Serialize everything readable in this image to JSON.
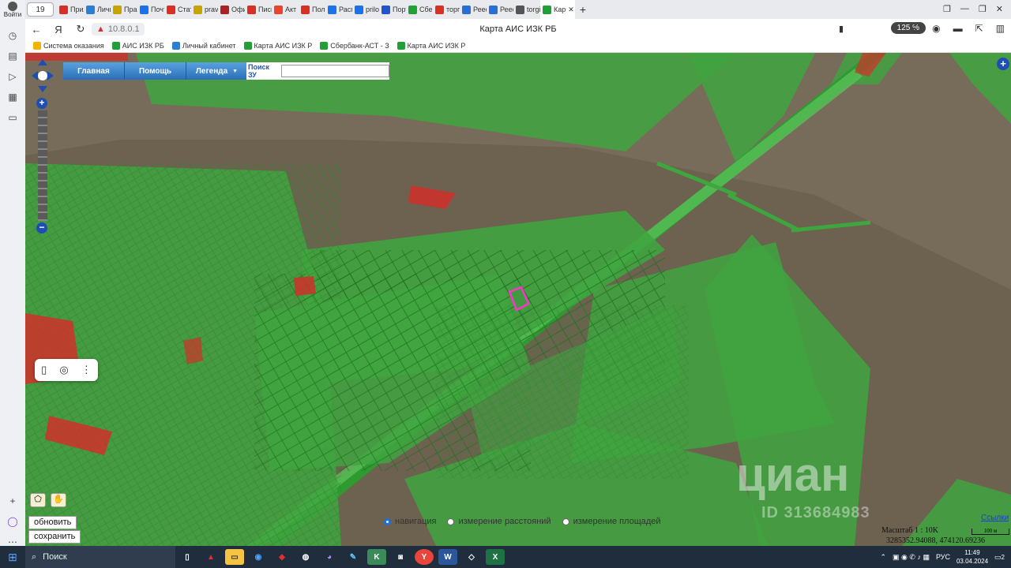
{
  "browser": {
    "tab_count": "19",
    "tabs": [
      {
        "label": "Прило",
        "color": "#d93025"
      },
      {
        "label": "Личн",
        "color": "#2a7fd4"
      },
      {
        "label": "Прави",
        "color": "#c8a400"
      },
      {
        "label": "Почта",
        "color": "#1a73e8"
      },
      {
        "label": "Стати",
        "color": "#d93025"
      },
      {
        "label": "pravo",
        "color": "#c8a400"
      },
      {
        "label": "Офиц",
        "color": "#aa2222"
      },
      {
        "label": "Письм",
        "color": "#d93025"
      },
      {
        "label": "Акт пр",
        "color": "#e8452c"
      },
      {
        "label": "Полож",
        "color": "#d93025"
      },
      {
        "label": "Распо",
        "color": "#1a73e8"
      },
      {
        "label": "prilozh",
        "color": "#1a73e8"
      },
      {
        "label": "Портa",
        "color": "#2255cc"
      },
      {
        "label": "Сберб",
        "color": "#21a038"
      },
      {
        "label": "торги",
        "color": "#d93025"
      },
      {
        "label": "Реестр",
        "color": "#2a6fd4"
      },
      {
        "label": "Реестр",
        "color": "#2a6fd4"
      },
      {
        "label": "torgi.g",
        "color": "#555555"
      },
      {
        "label": "Кар",
        "color": "#21a038"
      }
    ],
    "address": "10.8.0.1",
    "page_title": "Карта АИС ИЗК РБ",
    "zoom": "125 %",
    "login_label": "Войти"
  },
  "bookmarks": [
    {
      "label": "Система оказания",
      "color": "#f2b400"
    },
    {
      "label": "АИС ИЗК РБ",
      "color": "#21a038"
    },
    {
      "label": "Личный кабинет",
      "color": "#2a7fd4"
    },
    {
      "label": "Карта АИС ИЗК Р",
      "color": "#21a038"
    },
    {
      "label": "Сбербанк-АСТ - З",
      "color": "#21a038"
    },
    {
      "label": "Карта АИС ИЗК Р",
      "color": "#21a038"
    }
  ],
  "map": {
    "menu": [
      "Главная",
      "Помощь",
      "Легенда"
    ],
    "search_label": "Поиск ЗУ",
    "search_value": "",
    "buttons": {
      "refresh": "обновить",
      "save": "сохранить"
    },
    "modes": [
      "навигация",
      "измерение расстояний",
      "измерение площадей"
    ],
    "selected_mode": "навигация",
    "scale": "Масштаб 1 : 10K",
    "scalebar_label": "100 м",
    "coords": "3285352.94088, 474120.69236",
    "links": "Ссылки",
    "watermark": "циан",
    "watermark_id": "ID 313684983"
  },
  "taskbar": {
    "search": "Поиск",
    "lang": "РУС",
    "time": "11:49",
    "date": "03.04.2024",
    "notif": "2"
  }
}
